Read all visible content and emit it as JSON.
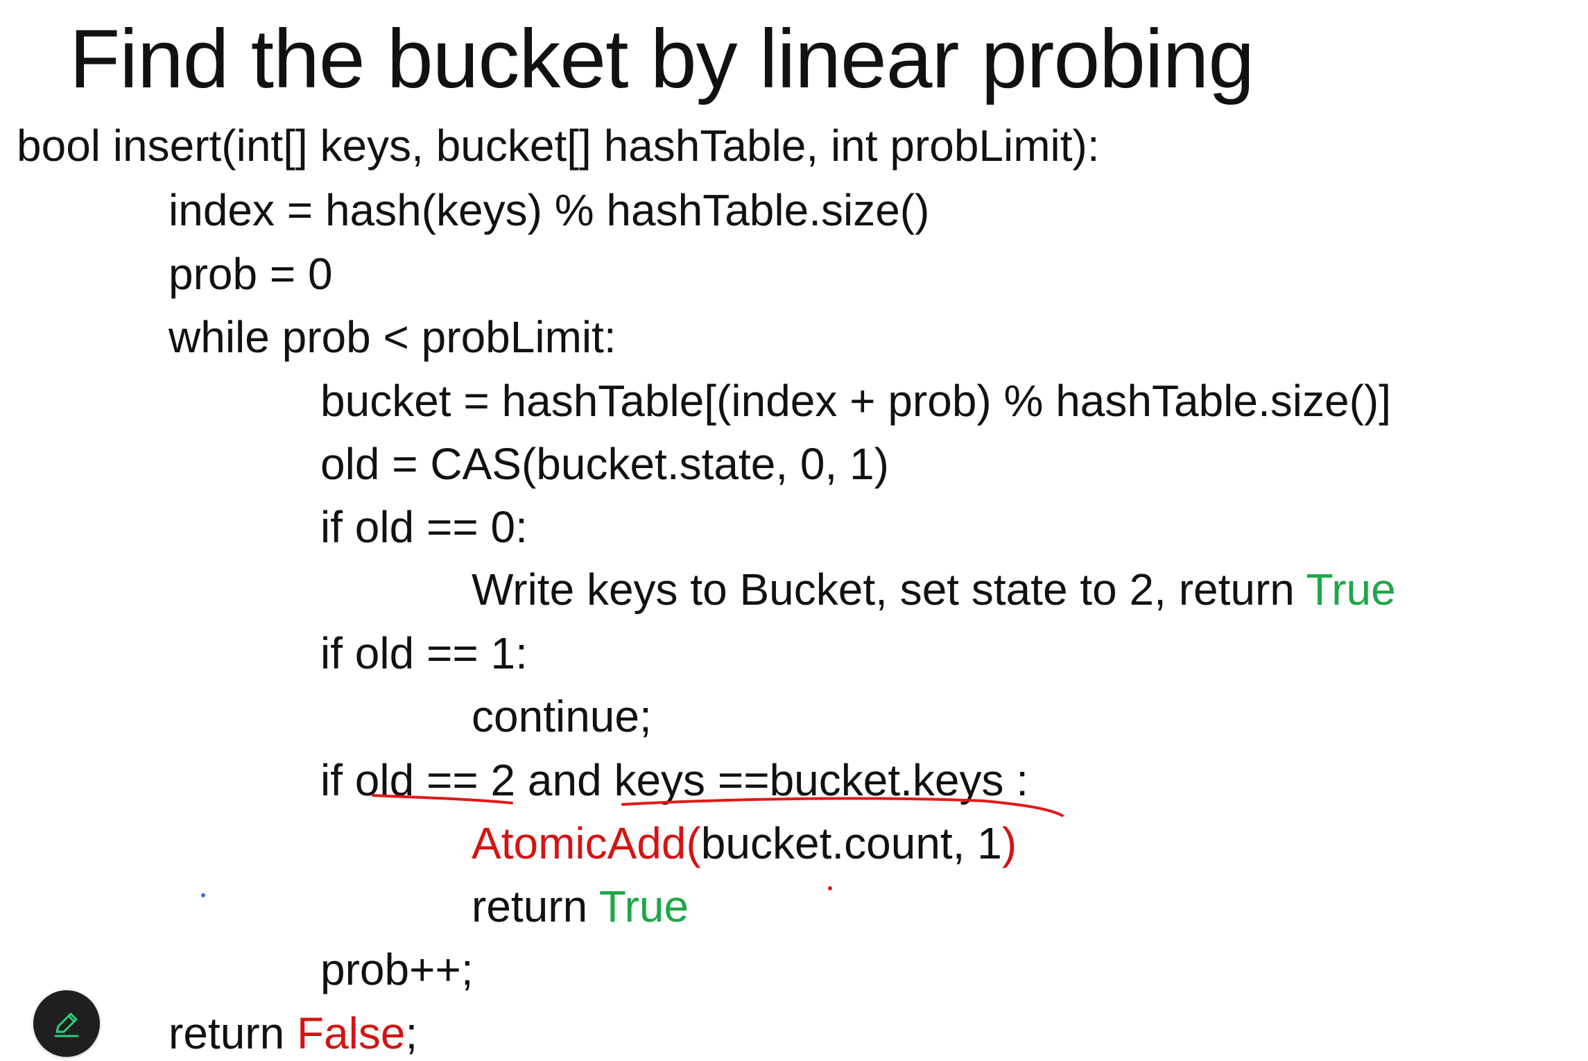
{
  "slide": {
    "title": "Find the bucket by linear probing"
  },
  "code": {
    "signature": "bool insert(int[] keys, bucket[] hashTable, int probLimit):",
    "line_index": "index = hash(keys) % hashTable.size()",
    "line_prob_init": "prob = 0",
    "line_while": "while prob < probLimit:",
    "line_bucket": "bucket = hashTable[(index + prob) % hashTable.size()]",
    "line_cas": "old = CAS(bucket.state, 0, 1)",
    "line_if0": "if old == 0:",
    "line_write_prefix": "Write keys to Bucket, set state to 2, return ",
    "line_write_true": "True",
    "line_if1": "if old == 1:",
    "line_continue": "continue;",
    "line_if2_a": "if ",
    "line_if2_b": "old == 2",
    "line_if2_c": " and ",
    "line_if2_d": "keys ==bucket.keys",
    "line_if2_e": " :",
    "line_atomic_fn": "AtomicAdd(",
    "line_atomic_args": "bucket.count, 1",
    "line_atomic_close": ")",
    "line_return_prefix": "return ",
    "line_return_true": "True",
    "line_prob_inc": "prob++;",
    "line_return_false_prefix": "return ",
    "line_return_false": "False",
    "line_return_false_suffix": ";"
  },
  "colors": {
    "keyword_true": "#1fa64a",
    "keyword_false": "#d41414",
    "annotation_ink": "#e01919",
    "dot_blue": "#2f6fde",
    "pen_button_bg": "#1f1f1f",
    "pen_icon": "#2ecf7a"
  },
  "toolbar": {
    "pen_icon": "pencil-icon"
  }
}
